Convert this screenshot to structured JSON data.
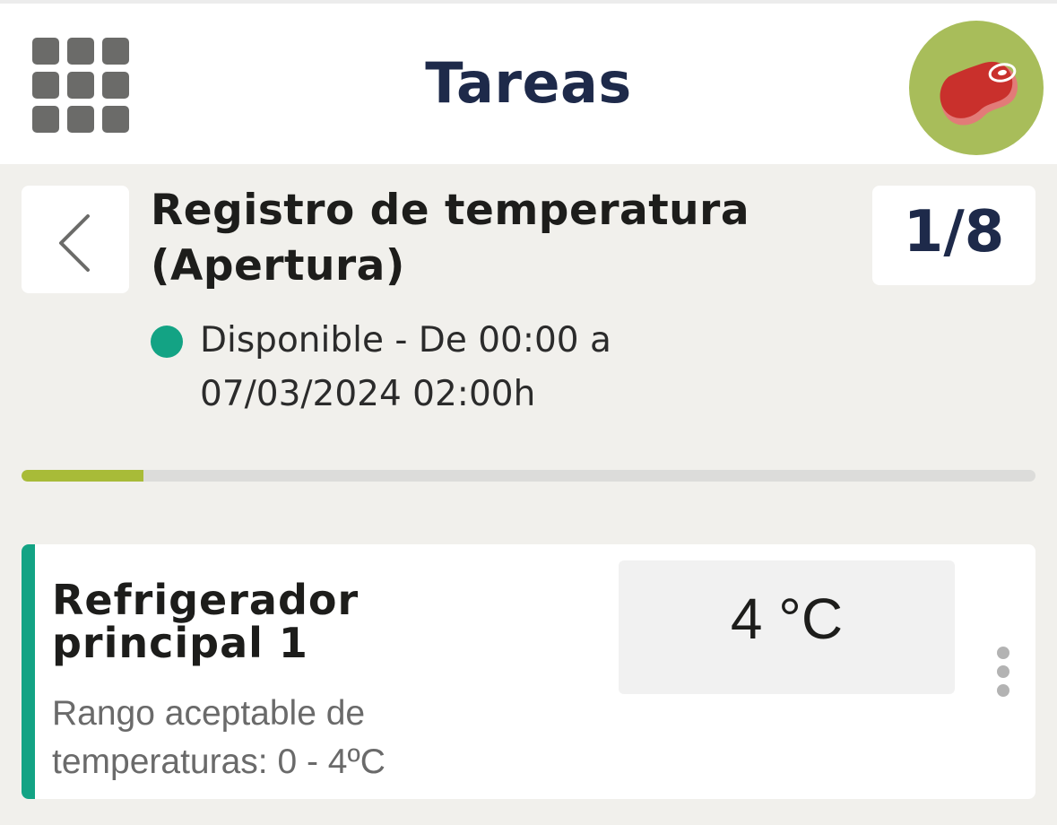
{
  "header": {
    "title": "Tareas",
    "menu_icon": "grid-menu-icon",
    "avatar_icon": "meat-steak-icon",
    "avatar_color": "#a8bd5a"
  },
  "task": {
    "title": "Registro de temperatura (Apertura)",
    "counter": "1/8",
    "status_line1": "Disponible - De 00:00 a",
    "status_line2": "07/03/2024 02:00h",
    "status_color": "#13a384",
    "back_icon": "chevron-left-icon"
  },
  "progress": {
    "completed_fraction": 0.12,
    "fill_color": "#a8bb38"
  },
  "item": {
    "title": "Refrigerador principal 1",
    "description_line1": "Rango aceptable de",
    "description_line2": "temperaturas: 0 - 4ºC",
    "value": "4 °C",
    "accent_color": "#13a384",
    "more_icon": "more-vertical-icon"
  }
}
